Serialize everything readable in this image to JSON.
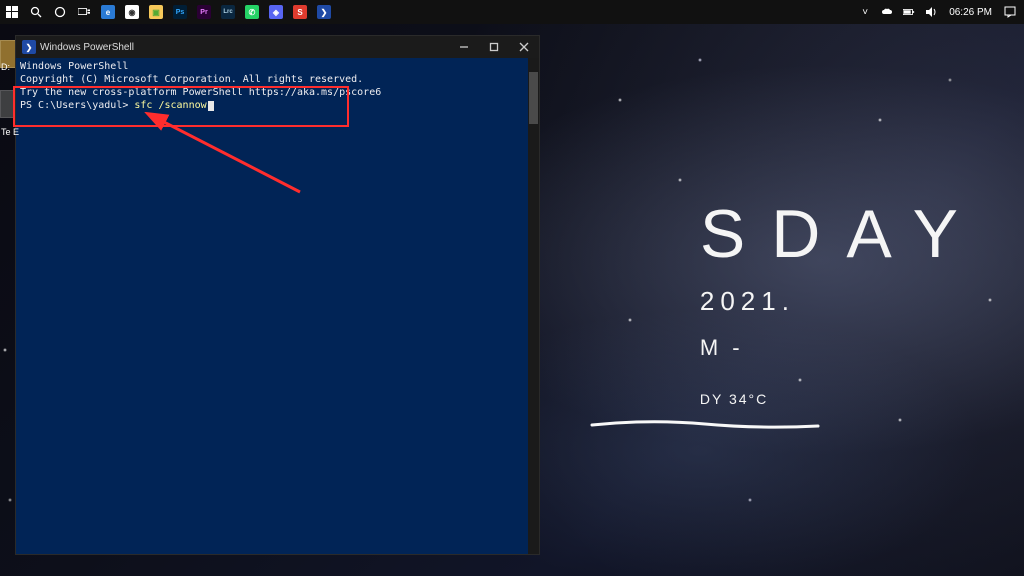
{
  "taskbar": {
    "start_icon": "start-icon",
    "search_icon": "search-icon",
    "cortana_icon": "cortana-icon",
    "taskview_icon": "taskview-icon",
    "pinned": [
      {
        "name": "edge-icon",
        "color": "#2a7ad4",
        "glyph": "e"
      },
      {
        "name": "chrome-icon",
        "color": "#ffffff",
        "glyph": "◉"
      },
      {
        "name": "explorer-icon",
        "color": "#f7c95a",
        "glyph": "▣"
      },
      {
        "name": "photoshop-icon",
        "color": "#001e36",
        "glyph": "Ps"
      },
      {
        "name": "premiere-icon",
        "color": "#2a0034",
        "glyph": "Pr"
      },
      {
        "name": "lightroom-icon",
        "color": "#0a2740",
        "glyph": "Lrc"
      },
      {
        "name": "whatsapp-icon",
        "color": "#25d366",
        "glyph": "✆"
      },
      {
        "name": "discord-icon",
        "color": "#5865f2",
        "glyph": "◈"
      },
      {
        "name": "snagit-icon",
        "color": "#e03b2e",
        "glyph": "S"
      },
      {
        "name": "powershell-icon",
        "color": "#1f4aa5",
        "glyph": "❯"
      }
    ],
    "tray": {
      "chevron": "˅",
      "clock": "06:26 PM"
    }
  },
  "widget": {
    "day_partial": "SDAY",
    "year_partial": "2021.",
    "meridiem_partial": "M -",
    "temp_partial": "DY 34°C"
  },
  "powershell": {
    "window_title": "Windows PowerShell",
    "lines": {
      "l1": "Windows PowerShell",
      "l2": "Copyright (C) Microsoft Corporation. All rights reserved.",
      "l3": "",
      "l4": "Try the new cross-platform PowerShell https://aka.ms/pscore6",
      "l5": "",
      "prompt_prefix": "PS C:\\Users\\yadul> ",
      "command": "sfc /scannow"
    }
  },
  "left_overlays": {
    "d": "D:",
    "te": "Te E"
  }
}
